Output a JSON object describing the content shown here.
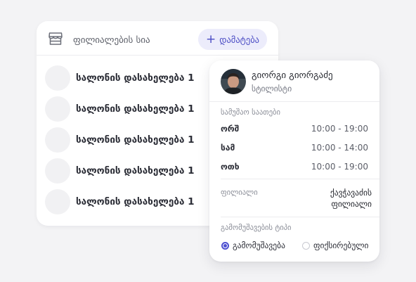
{
  "branches": {
    "title": "ფილიალების სია",
    "icon": "store-icon",
    "add_button": {
      "icon": "plus-icon",
      "label": "დამატება"
    },
    "items": [
      {
        "name": "სალონის დასახელება 1"
      },
      {
        "name": "სალონის დასახელება 1"
      },
      {
        "name": "სალონის დასახელება 1"
      },
      {
        "name": "სალონის დასახელება 1"
      },
      {
        "name": "სალონის დასახელება 1"
      }
    ]
  },
  "profile": {
    "name": "გიორგი გიორგაძე",
    "role": "სტილისტი",
    "working_hours": {
      "label": "სამუშაო საათები",
      "rows": [
        {
          "day": "ორშ",
          "time": "10:00 - 19:00"
        },
        {
          "day": "სამ",
          "time": "10:00 - 14:00"
        },
        {
          "day": "ოთხ",
          "time": "10:00 - 19:00"
        }
      ]
    },
    "branch": {
      "label": "ფილიალი",
      "value_line1": "ქავჭავაძის",
      "value_line2": "ფილიალი"
    },
    "employment": {
      "label": "გამომუშავების ტიპი",
      "options": [
        {
          "label": "გამომუშავება",
          "selected": true
        },
        {
          "label": "ფიქსირებული",
          "selected": false
        }
      ]
    }
  },
  "colors": {
    "accent": "#4e51d1",
    "accent_bg": "#ececfb",
    "background": "#f3f3f5"
  }
}
